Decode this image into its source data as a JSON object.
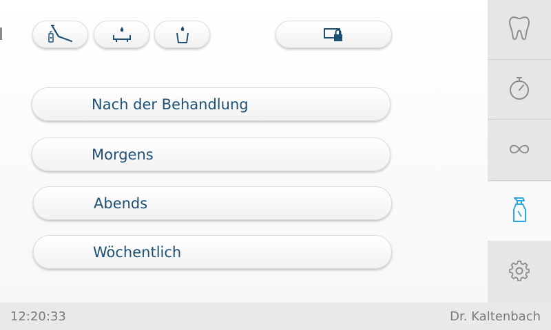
{
  "toolbar": {
    "icons": [
      "chair-flush-icon",
      "bowl-rinse-icon",
      "cup-fill-icon",
      "screen-lock-icon"
    ]
  },
  "menu": {
    "items": [
      {
        "label": "Nach der Behandlung"
      },
      {
        "label": "Morgens"
      },
      {
        "label": "Abends"
      },
      {
        "label": "Wöchentlich"
      }
    ]
  },
  "sidebar": {
    "items": [
      {
        "name": "tooth-icon"
      },
      {
        "name": "stopwatch-icon"
      },
      {
        "name": "infinity-icon"
      },
      {
        "name": "spray-bottle-icon",
        "active": true
      },
      {
        "name": "gear-icon"
      }
    ]
  },
  "status": {
    "time": "12:20:33",
    "user": "Dr. Kaltenbach"
  },
  "colors": {
    "text_blue": "#1d4f72",
    "accent_cyan": "#29a9e0",
    "icon_gray": "#8c8c8c"
  }
}
